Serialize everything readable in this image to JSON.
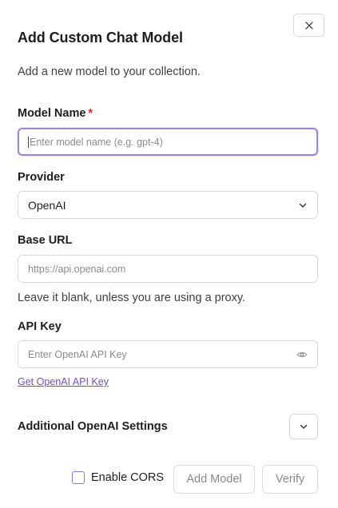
{
  "dialog": {
    "title": "Add Custom Chat Model",
    "subtitle": "Add a new model to your collection."
  },
  "model_name": {
    "label": "Model Name",
    "required_mark": "*",
    "placeholder": "Enter model name (e.g. gpt-4)",
    "value": ""
  },
  "provider": {
    "label": "Provider",
    "value": "OpenAI"
  },
  "base_url": {
    "label": "Base URL",
    "placeholder": "https://api.openai.com",
    "helper": "Leave it blank, unless you are using a proxy."
  },
  "api_key": {
    "label": "API Key",
    "placeholder": "Enter OpenAI API Key",
    "link": "Get OpenAI API Key"
  },
  "additional": {
    "label": "Additional OpenAI Settings"
  },
  "footer": {
    "cors_label": "Enable CORS",
    "add_label": "Add Model",
    "verify_label": "Verify"
  },
  "colors": {
    "focus_border": "#9b86d8",
    "link": "#6d4fc2",
    "required": "#dc2626",
    "checkbox_border": "#8c74d4"
  },
  "icons": {
    "close": "close-icon",
    "select_chevron": "chevron-down-icon",
    "visibility": "eye-icon",
    "expand": "chevron-down-icon"
  }
}
